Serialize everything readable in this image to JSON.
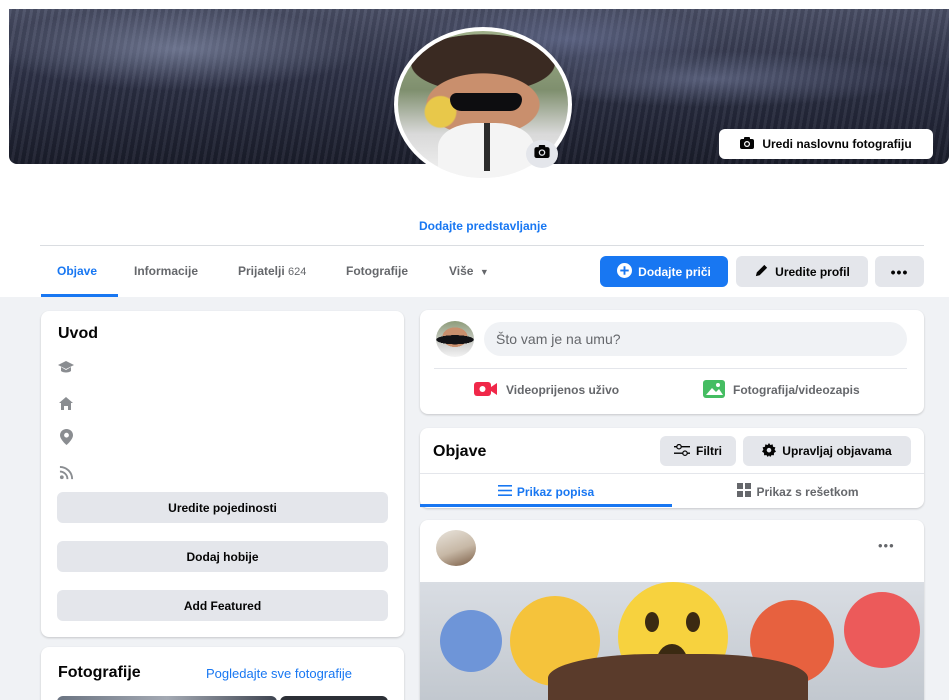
{
  "cover": {
    "edit_label": "Uredi naslovnu fotografiju",
    "camera_icon": "camera-icon"
  },
  "profile": {
    "add_intro_link": "Dodajte predstavljanje",
    "avatar_camera_icon": "camera-icon"
  },
  "tabs": [
    {
      "label": "Objave",
      "active": true
    },
    {
      "label": "Informacije",
      "active": false
    },
    {
      "label": "Prijatelji",
      "count": "624",
      "active": false
    },
    {
      "label": "Fotografije",
      "active": false
    },
    {
      "label": "Više",
      "active": false,
      "icon": "caret-down-icon"
    }
  ],
  "actions": {
    "add_story": "Dodajte priči",
    "edit_profile": "Uredite profil",
    "more_icon": "more-horizontal-icon"
  },
  "intro": {
    "title": "Uvod",
    "icons": [
      "graduation-cap-icon",
      "home-icon",
      "location-pin-icon",
      "rss-icon"
    ],
    "edit_details": "Uredite pojedinosti",
    "add_hobbies": "Dodaj hobije",
    "add_featured": "Add Featured"
  },
  "photos": {
    "title": "Fotografije",
    "see_all": "Pogledajte sve fotografije"
  },
  "composer": {
    "placeholder": "Što vam je na umu?",
    "live_video": "Videoprijenos uživo",
    "photo_video": "Fotografija/videozapis"
  },
  "posts_header": {
    "title": "Objave",
    "filters": "Filtri",
    "manage": "Upravljaj objavama",
    "list_view": "Prikaz popisa",
    "grid_view": "Prikaz s rešetkom",
    "active_view": "list"
  },
  "post": {
    "more_icon": "more-horizontal-icon"
  },
  "colors": {
    "accent": "#1877f2",
    "page_bg": "#f0f2f5",
    "live_red": "#f02849",
    "photo_green": "#45bd62"
  }
}
